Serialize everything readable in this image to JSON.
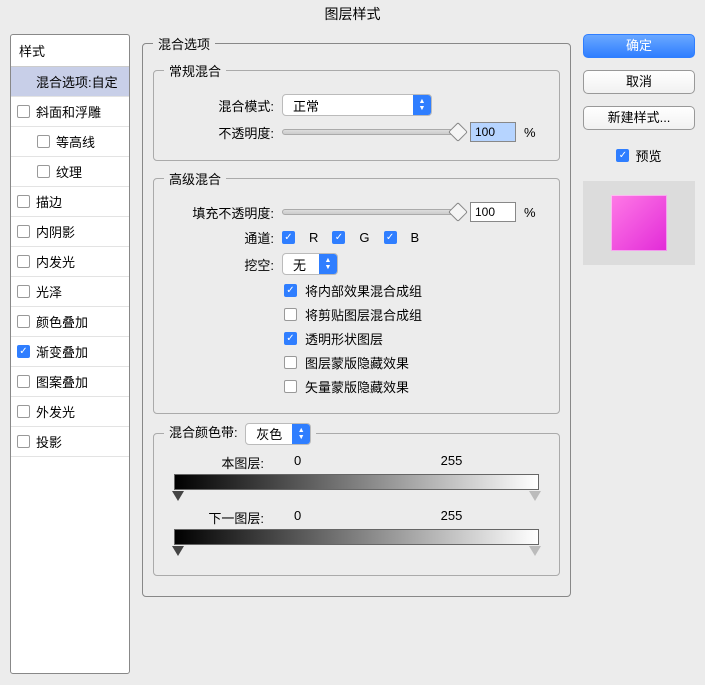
{
  "title": "图层样式",
  "sidebar": {
    "header": "样式",
    "items": [
      {
        "label": "混合选项:自定",
        "checked": null,
        "selected": true
      },
      {
        "label": "斜面和浮雕",
        "checked": false
      },
      {
        "label": "等高线",
        "checked": false,
        "indent": true
      },
      {
        "label": "纹理",
        "checked": false,
        "indent": true
      },
      {
        "label": "描边",
        "checked": false
      },
      {
        "label": "内阴影",
        "checked": false
      },
      {
        "label": "内发光",
        "checked": false
      },
      {
        "label": "光泽",
        "checked": false
      },
      {
        "label": "颜色叠加",
        "checked": false
      },
      {
        "label": "渐变叠加",
        "checked": true
      },
      {
        "label": "图案叠加",
        "checked": false
      },
      {
        "label": "外发光",
        "checked": false
      },
      {
        "label": "投影",
        "checked": false
      }
    ]
  },
  "blending": {
    "legend": "混合选项",
    "general": {
      "legend": "常规混合",
      "mode_label": "混合模式:",
      "mode_value": "正常",
      "opacity_label": "不透明度:",
      "opacity_value": "100",
      "opacity_unit": "%"
    },
    "advanced": {
      "legend": "高级混合",
      "fill_label": "填充不透明度:",
      "fill_value": "100",
      "fill_unit": "%",
      "channel_label": "通道:",
      "ch_r": "R",
      "ch_g": "G",
      "ch_b": "B",
      "knockout_label": "挖空:",
      "knockout_value": "无",
      "opts": [
        {
          "label": "将内部效果混合成组",
          "checked": true
        },
        {
          "label": "将剪贴图层混合成组",
          "checked": false
        },
        {
          "label": "透明形状图层",
          "checked": true
        },
        {
          "label": "图层蒙版隐藏效果",
          "checked": false
        },
        {
          "label": "矢量蒙版隐藏效果",
          "checked": false
        }
      ]
    },
    "blendif": {
      "legend": "混合颜色带:",
      "channel_value": "灰色",
      "this_label": "本图层:",
      "this_lo": "0",
      "this_hi": "255",
      "under_label": "下一图层:",
      "under_lo": "0",
      "under_hi": "255"
    }
  },
  "right": {
    "ok": "确定",
    "cancel": "取消",
    "newstyle": "新建样式...",
    "preview": "预览"
  }
}
